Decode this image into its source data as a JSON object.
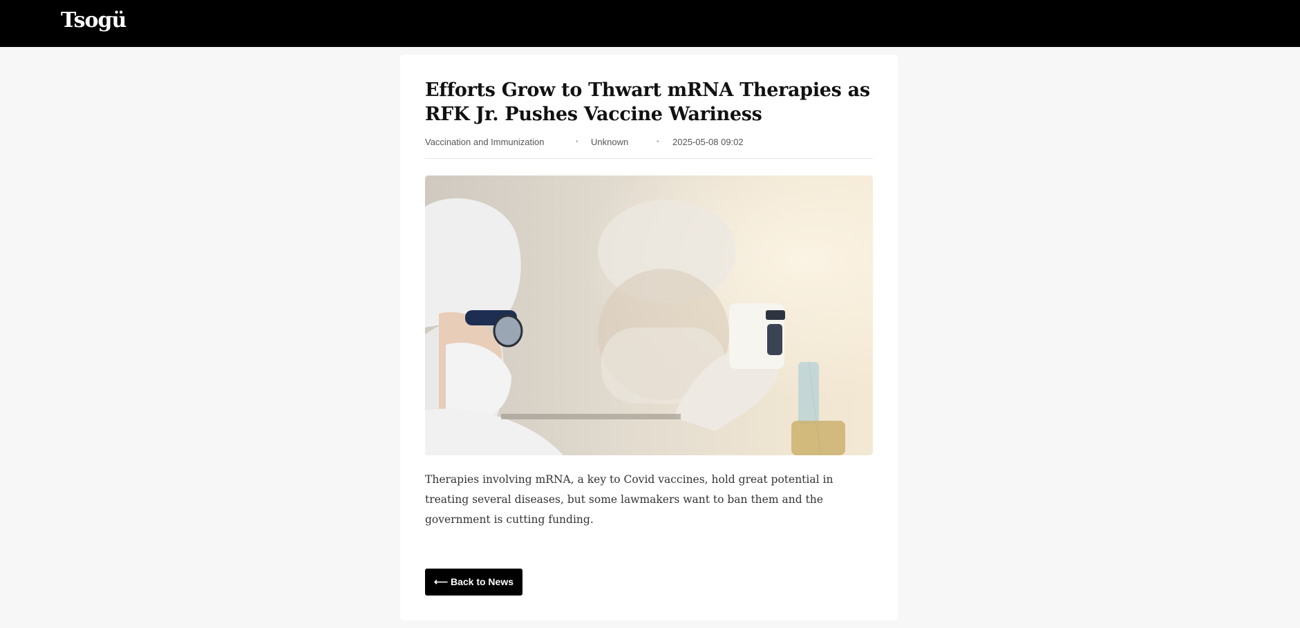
{
  "header": {
    "logo_text": "Tsogü"
  },
  "article": {
    "title": "Efforts Grow to Thwart mRNA Therapies as RFK Jr. Pushes Vaccine Wariness",
    "category": "Vaccination and Immunization",
    "author": "Unknown",
    "date": "2025-05-08 09:02",
    "separator": "•",
    "summary": "Therapies involving mRNA, a key to Covid vaccines, hold great potential in treating several diseases, but some lawmakers want to ban them and the government is cutting funding.",
    "back_label": "⟵ Back to News"
  },
  "colors": {
    "topbar": "#000000",
    "page_background": "#f7f7f7",
    "card_background": "#ffffff",
    "button": "#000000"
  }
}
